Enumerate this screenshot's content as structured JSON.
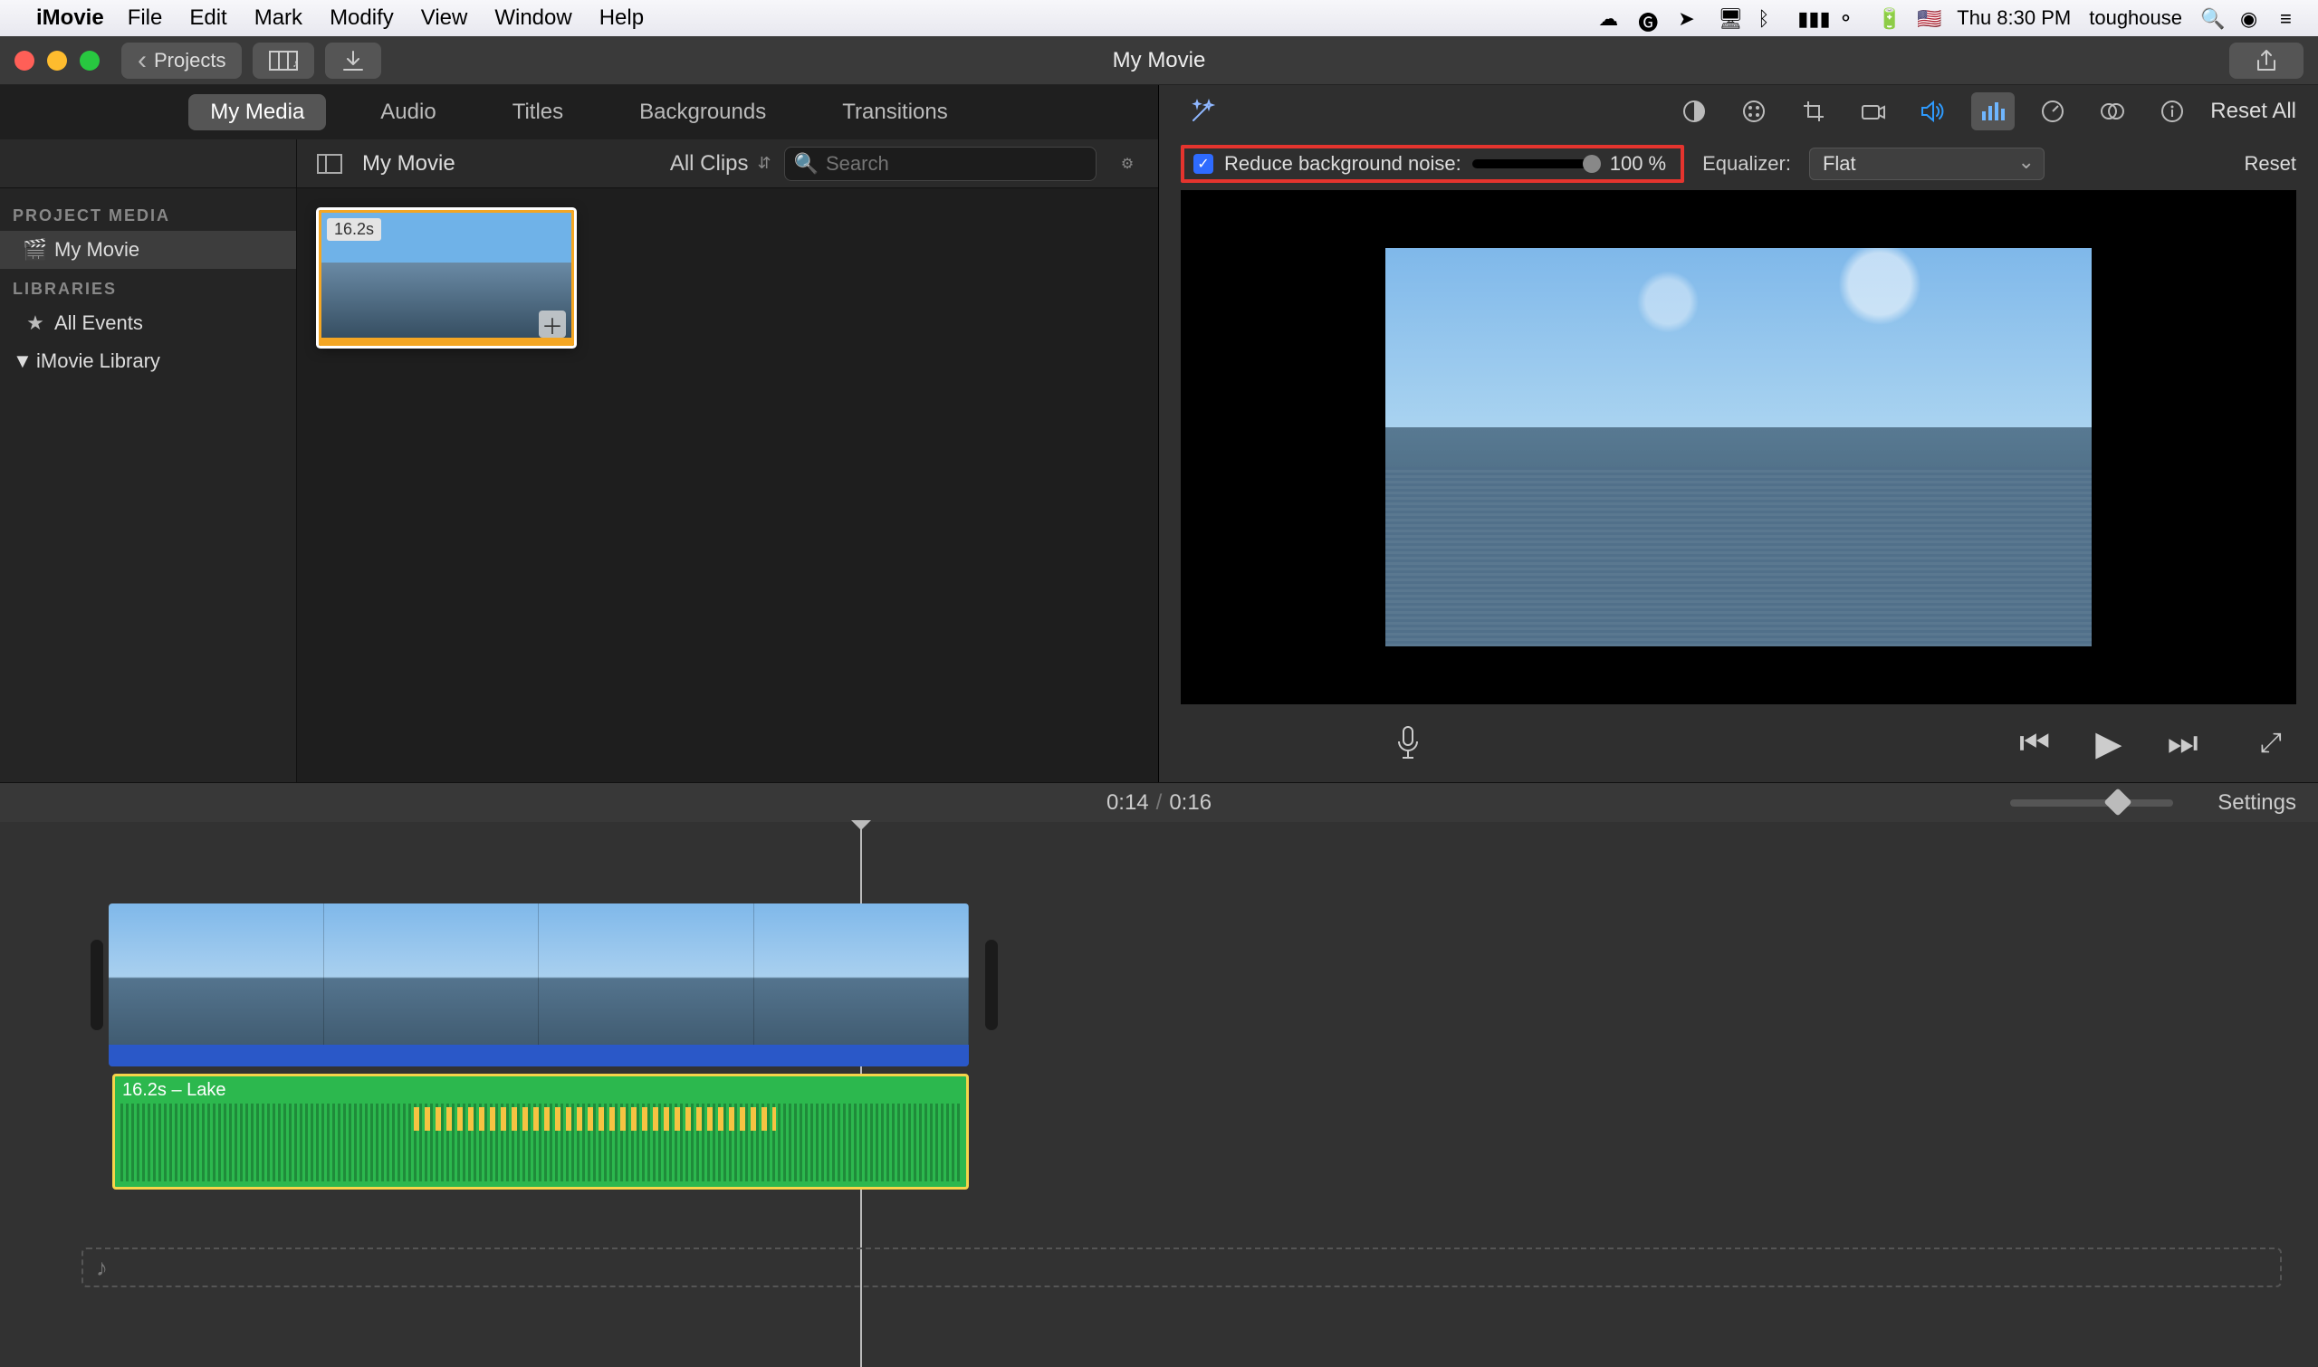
{
  "menubar": {
    "app": "iMovie",
    "items": [
      "File",
      "Edit",
      "Mark",
      "Modify",
      "View",
      "Window",
      "Help"
    ],
    "clock": "Thu 8:30 PM",
    "user": "toughouse"
  },
  "titlebar": {
    "back_label": "Projects",
    "title": "My Movie"
  },
  "library_tabs": {
    "items": [
      "My Media",
      "Audio",
      "Titles",
      "Backgrounds",
      "Transitions"
    ],
    "active_index": 0
  },
  "browser_header": {
    "crumb": "My Movie",
    "filter_label": "All Clips",
    "search_placeholder": "Search"
  },
  "sidebar": {
    "heading_project": "PROJECT MEDIA",
    "project_item": "My Movie",
    "heading_libs": "LIBRARIES",
    "all_events": "All Events",
    "library": "iMovie Library"
  },
  "clip": {
    "duration": "16.2s"
  },
  "inspector": {
    "reset_all": "Reset All",
    "noise_label": "Reduce background noise:",
    "noise_value": "100 %",
    "eq_label": "Equalizer:",
    "eq_value": "Flat",
    "reset": "Reset"
  },
  "timeline": {
    "pos": "0:14",
    "dur": "0:16",
    "settings": "Settings",
    "audio_label": "16.2s – Lake"
  }
}
